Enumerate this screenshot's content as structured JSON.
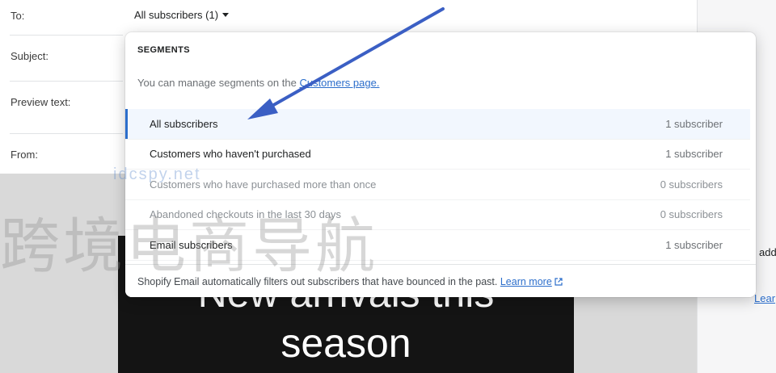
{
  "form": {
    "to_label": "To:",
    "to_value": "All subscribers (1)",
    "subject_label": "Subject:",
    "preview_label": "Preview text:",
    "from_label": "From:"
  },
  "segments_popover": {
    "heading": "SEGMENTS",
    "hint_prefix": "You can manage segments on the ",
    "hint_link": "Customers page.",
    "items": [
      {
        "name": "All subscribers",
        "count": "1 subscriber",
        "selected": true,
        "disabled": false
      },
      {
        "name": "Customers who haven't purchased",
        "count": "1 subscriber",
        "selected": false,
        "disabled": false
      },
      {
        "name": "Customers who have purchased more than once",
        "count": "0 subscribers",
        "selected": false,
        "disabled": true
      },
      {
        "name": "Abandoned checkouts in the last 30 days",
        "count": "0 subscribers",
        "selected": false,
        "disabled": true
      },
      {
        "name": "Email subscribers",
        "count": "1 subscriber",
        "selected": false,
        "disabled": false
      }
    ],
    "footer_text": "Shopify Email automatically filters out subscribers that have bounced in the past.",
    "footer_link": "Learn more"
  },
  "preview": {
    "title_line1": "New arrivals this",
    "title_line2": "season"
  },
  "sidebar": {
    "text_fragment": "add",
    "link_fragment": "Lear"
  },
  "watermark": {
    "text": "跨境电商导航",
    "domain": "idcspy.net"
  },
  "colors": {
    "accent": "#2c6ecb",
    "arrow": "#3b5fc4",
    "selected_bg": "#f2f7fe"
  }
}
